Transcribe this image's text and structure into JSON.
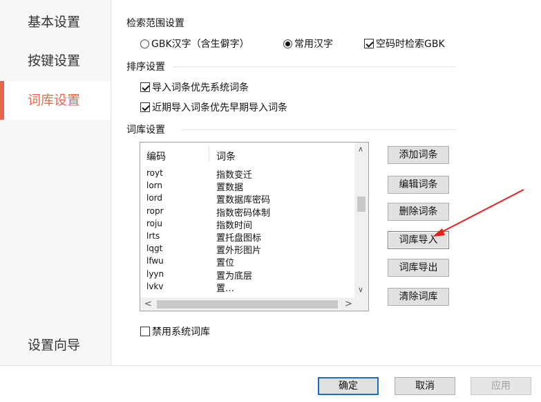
{
  "sidebar": {
    "items": [
      {
        "label": "基本设置"
      },
      {
        "label": "按键设置"
      },
      {
        "label": "词库设置"
      }
    ],
    "wizard_label": "设置向导"
  },
  "search_scope": {
    "title": "检索范围设置",
    "options": [
      {
        "label": "GBK汉字（含生僻字）",
        "checked": false
      },
      {
        "label": "常用汉字",
        "checked": true
      }
    ],
    "empty_code_gbk_label": "空码时检索GBK"
  },
  "sorting": {
    "title": "排序设置",
    "opt1_label": "导入词条优先系统词条",
    "opt2_label": "近期导入词条优先早期导入词条"
  },
  "dictionary": {
    "title": "词库设置",
    "columns": {
      "code": "编码",
      "word": "词条"
    },
    "rows": [
      {
        "code": "royt",
        "word": "指数变迁"
      },
      {
        "code": "lorn",
        "word": "置数据"
      },
      {
        "code": "lord",
        "word": "置数据库密码"
      },
      {
        "code": "ropr",
        "word": "指数密码体制"
      },
      {
        "code": "roju",
        "word": "指数时间"
      },
      {
        "code": "lrts",
        "word": "置托盘图标"
      },
      {
        "code": "lqgt",
        "word": "置外形图片"
      },
      {
        "code": "lfwu",
        "word": "置位"
      },
      {
        "code": "lyyn",
        "word": "置为底层"
      },
      {
        "code": "lvkv",
        "word": "置…"
      }
    ],
    "buttons": {
      "add": "添加词条",
      "edit": "编辑词条",
      "delete": "删除词条",
      "import": "词库导入",
      "export": "词库导出",
      "clear": "清除词库"
    },
    "disable_system_label": "禁用系统词库"
  },
  "footer": {
    "ok": "确定",
    "cancel": "取消",
    "apply": "应用"
  },
  "colors": {
    "accent": "#e8664f",
    "annotation_arrow": "#e8201c"
  }
}
